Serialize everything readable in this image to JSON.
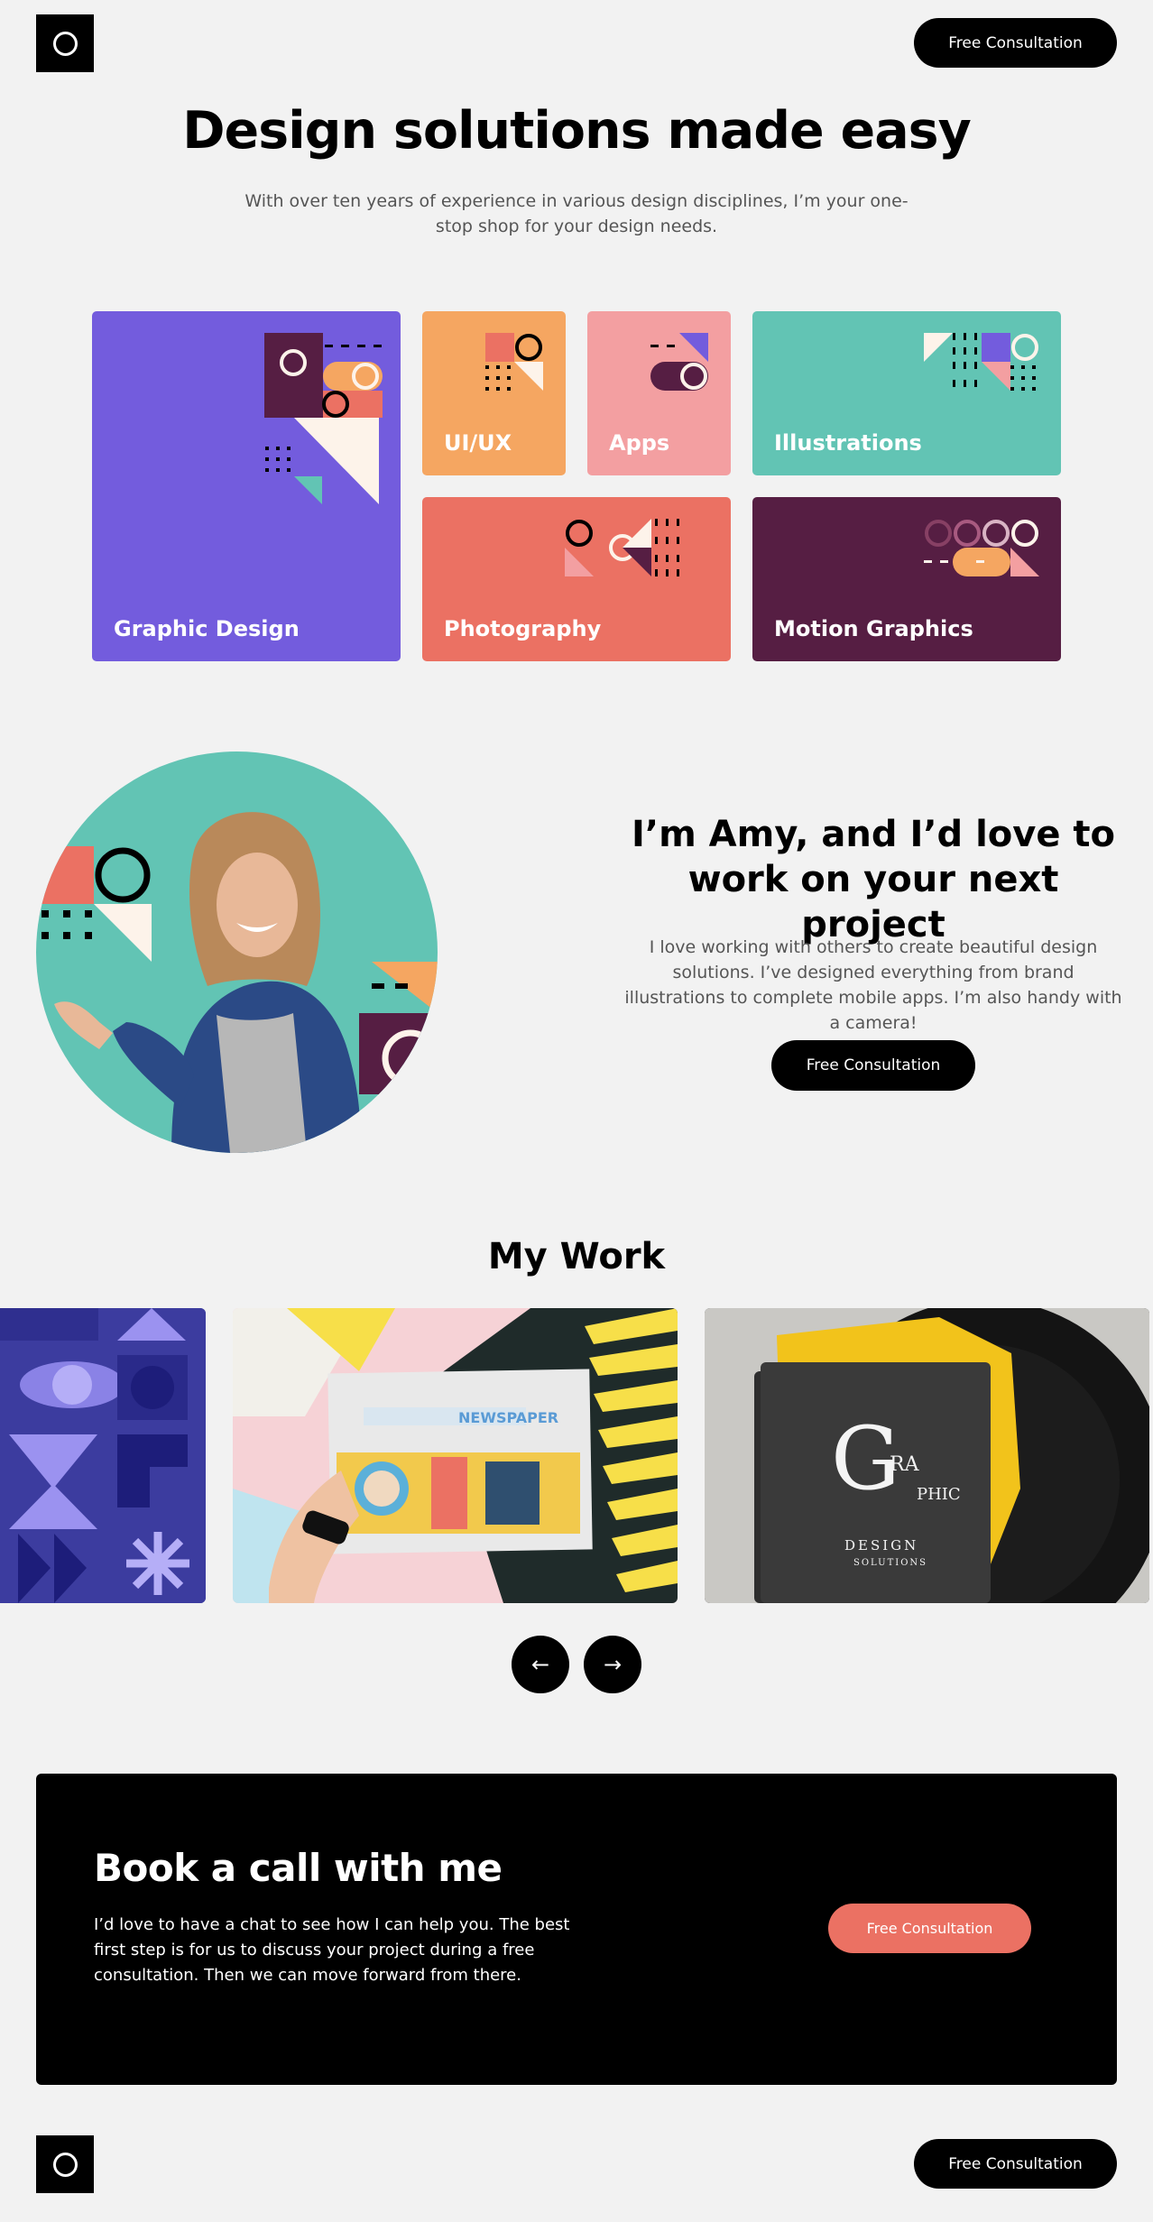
{
  "header": {
    "logo": "circle-logo",
    "cta_label": "Free Consultation"
  },
  "hero": {
    "title": "Design solutions made easy",
    "subtitle": "With over ten years of experience in various design disciplines, I’m your one-stop shop for your design needs."
  },
  "services": [
    {
      "label": "Graphic Design",
      "color": "#735cdd"
    },
    {
      "label": "UI/UX",
      "color": "#f5a661"
    },
    {
      "label": "Apps",
      "color": "#f39fa1"
    },
    {
      "label": "Illustrations",
      "color": "#62c4b4"
    },
    {
      "label": "Photography",
      "color": "#eb7163"
    },
    {
      "label": "Motion Graphics",
      "color": "#561e43"
    }
  ],
  "about": {
    "title": "I’m Amy, and I’d love to work on your next project",
    "text": "I love working with others to create beautiful design solutions. I’ve designed everything from brand illustrations to complete mobile apps. I’m also handy with a camera!",
    "cta_label": "Free Consultation"
  },
  "work": {
    "title": "My Work",
    "prev_icon": "arrow-left-icon",
    "next_icon": "arrow-right-icon",
    "newspaper_masthead": "NEWSPAPER",
    "book_text": [
      "G",
      "RA",
      "PHIC",
      "DESIGN",
      "SOLUTIONS"
    ]
  },
  "cta": {
    "title": "Book a call with me",
    "text": "I’d love to have a chat to see how I can help you. The best first step is for us to discuss your project during a free consultation. Then we can move forward from there.",
    "button_label": "Free Consultation"
  },
  "footer": {
    "logo": "circle-logo",
    "cta_label": "Free Consultation"
  },
  "colors": {
    "purple": "#735cdd",
    "orange": "#f5a661",
    "pink": "#f39fa1",
    "teal": "#62c4b4",
    "red": "#eb7163",
    "plum": "#561e43",
    "cream": "#fdf3ea"
  }
}
